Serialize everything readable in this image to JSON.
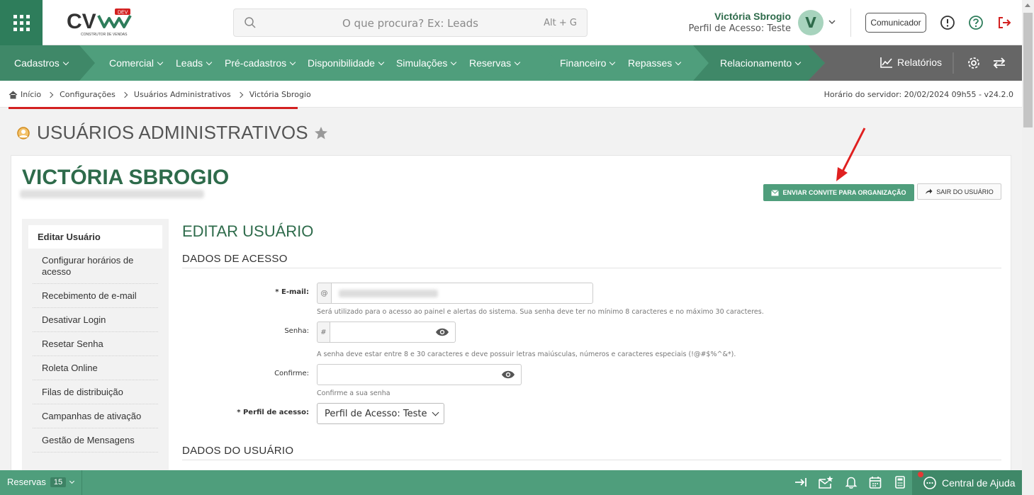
{
  "header": {
    "search_placeholder": "O que procura? Ex: Leads",
    "search_shortcut": "Alt + G",
    "user_name": "Victória Sbrogio",
    "user_profile": "Perfil de Acesso: Teste",
    "avatar_initial": "V",
    "comunicador": "Comunicador",
    "logo_text": "CV",
    "logo_badge": "DEV",
    "logo_tagline": "CONSTRUTOR DE VENDAS"
  },
  "nav": {
    "items": [
      "Cadastros",
      "Comercial",
      "Leads",
      "Pré-cadastros",
      "Disponibilidade",
      "Simulações",
      "Reservas",
      "Financeiro",
      "Repasses",
      "Relacionamento"
    ],
    "reports": "Relatórios"
  },
  "breadcrumb": {
    "items": [
      "Início",
      "Configurações",
      "Usuários Administrativos",
      "Victória Sbrogio"
    ],
    "server_time": "Horário do servidor: 20/02/2024 09h55 - v24.2.0"
  },
  "page": {
    "title": "USUÁRIOS ADMINISTRATIVOS",
    "user_heading": "VICTÓRIA SBROGIO",
    "btn_invite": "ENVIAR CONVITE PARA ORGANIZAÇÃO",
    "btn_exit": "SAIR DO USUÁRIO"
  },
  "sidemenu": {
    "items": [
      "Editar Usuário",
      "Configurar horários de acesso",
      "Recebimento de e-mail",
      "Desativar Login",
      "Resetar Senha",
      "Roleta Online",
      "Filas de distribuição",
      "Campanhas de ativação",
      "Gestão de Mensagens"
    ]
  },
  "form": {
    "title": "EDITAR USUÁRIO",
    "section_access": "DADOS DE ACESSO",
    "email_label": "E-mail:",
    "email_addon": "@",
    "email_help": "Será utilizado para o acesso ao painel e alertas do sistema. Sua senha deve ter no mínimo 8 caracteres e no máximo 30 caracteres.",
    "password_label": "Senha:",
    "password_addon": "#",
    "password_help": "A senha deve estar entre 8 e 30 caracteres e deve possuir letras maiúsculas, números e caracteres especiais (!@#$%^&*).",
    "confirm_label": "Confirme:",
    "confirm_help": "Confirme a sua senha",
    "profile_label": "Perfil de acesso:",
    "profile_value": "Perfil de Acesso: Teste",
    "required_mark": "*",
    "section_user": "DADOS DO USUÁRIO"
  },
  "footer": {
    "reservas": "Reservas",
    "reservas_count": "15",
    "help_center": "Central de Ajuda"
  },
  "colors": {
    "brand_dark": "#2e6b4b",
    "brand": "#4f9e7c",
    "nav_dark": "#3f8868",
    "alert": "#d32020"
  }
}
